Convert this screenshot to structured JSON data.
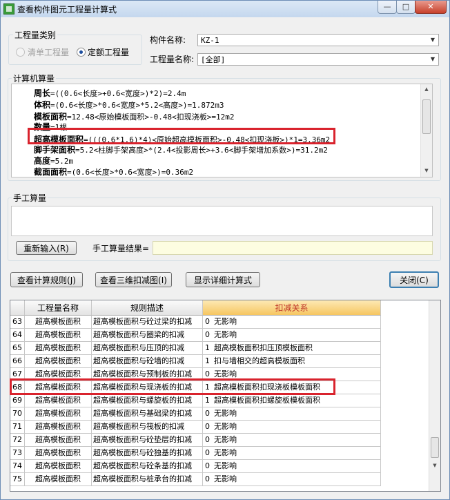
{
  "window": {
    "title": "查看构件图元工程量计算式",
    "controls": {
      "minimize": "—",
      "maximize": "□",
      "close": "✕"
    }
  },
  "quantity_type": {
    "group_label": "工程量类别",
    "options": [
      {
        "label": "清单工程量",
        "selected": false,
        "enabled": false
      },
      {
        "label": "定额工程量",
        "selected": true,
        "enabled": true
      }
    ]
  },
  "component": {
    "label": "构件名称:",
    "value": "KZ-1"
  },
  "quantity_name": {
    "label": "工程量名称:",
    "value": "[全部]"
  },
  "computer_calc": {
    "group_label": "计算机算量",
    "lines": [
      {
        "name": "周长",
        "expr": "=((0.6<长度>+0.6<宽度>)*2)=2.4m"
      },
      {
        "name": "体积",
        "expr": "=(0.6<长度>*0.6<宽度>*5.2<高度>)=1.872m3"
      },
      {
        "name": "模板面积",
        "expr": "=12.48<原始模板面积>-0.48<扣现浇板>=12m2"
      },
      {
        "name": "数量",
        "expr": "=1根"
      },
      {
        "name": "超高模板面积",
        "expr": "=(((0.6*1.6)*4)<原始超高模板面积>-0.48<扣现浇板>)*1=3.36m2"
      },
      {
        "name": "脚手架面积",
        "expr": "=5.2<柱脚手架高度>*(2.4<投影周长>+3.6<脚手架增加系数>)=31.2m2"
      },
      {
        "name": "高度",
        "expr": "=5.2m"
      },
      {
        "name": "截面面积",
        "expr": "=(0.6<长度>*0.6<宽度>)=0.36m2"
      }
    ]
  },
  "manual_calc": {
    "group_label": "手工算量",
    "reenter_button": "重新输入(R)",
    "result_label": "手工算量结果=",
    "result_value": ""
  },
  "buttons": {
    "view_rules": "查看计算规则(J)",
    "view_3d": "查看三维扣减图(I)",
    "show_detail": "显示详细计算式",
    "close": "关闭(C)"
  },
  "table": {
    "columns": [
      "",
      "工程量名称",
      "规则描述",
      "扣减关系"
    ],
    "rows": [
      {
        "num": "63",
        "name": "超高模板面积",
        "rule": "超高模板面积与砼过梁的扣减",
        "code": "0",
        "relation": "无影响"
      },
      {
        "num": "64",
        "name": "超高模板面积",
        "rule": "超高模板面积与圈梁的扣减",
        "code": "0",
        "relation": "无影响"
      },
      {
        "num": "65",
        "name": "超高模板面积",
        "rule": "超高模板面积与压顶的扣减",
        "code": "1",
        "relation": "超高模板面积扣压顶模板面积"
      },
      {
        "num": "66",
        "name": "超高模板面积",
        "rule": "超高模板面积与砼墙的扣减",
        "code": "1",
        "relation": "扣与墙相交的超高模板面积"
      },
      {
        "num": "67",
        "name": "超高模板面积",
        "rule": "超高模板面积与预制板的扣减",
        "code": "0",
        "relation": "无影响"
      },
      {
        "num": "68",
        "name": "超高模板面积",
        "rule": "超高模板面积与现浇板的扣减",
        "code": "1",
        "relation": "超高模板面积扣现浇板模板面积"
      },
      {
        "num": "69",
        "name": "超高模板面积",
        "rule": "超高模板面积与螺旋板的扣减",
        "code": "1",
        "relation": "超高模板面积扣螺旋板模板面积"
      },
      {
        "num": "70",
        "name": "超高模板面积",
        "rule": "超高模板面积与基础梁的扣减",
        "code": "0",
        "relation": "无影响"
      },
      {
        "num": "71",
        "name": "超高模板面积",
        "rule": "超高模板面积与筏板的扣减",
        "code": "0",
        "relation": "无影响"
      },
      {
        "num": "72",
        "name": "超高模板面积",
        "rule": "超高模板面积与砼垫层的扣减",
        "code": "0",
        "relation": "无影响"
      },
      {
        "num": "73",
        "name": "超高模板面积",
        "rule": "超高模板面积与砼独基的扣减",
        "code": "0",
        "relation": "无影响"
      },
      {
        "num": "74",
        "name": "超高模板面积",
        "rule": "超高模板面积与砼条基的扣减",
        "code": "0",
        "relation": "无影响"
      },
      {
        "num": "75",
        "name": "超高模板面积",
        "rule": "超高模板面积与桩承台的扣减",
        "code": "0",
        "relation": "无影响"
      }
    ]
  },
  "colors": {
    "highlight_border": "#d9232d",
    "active_header": "#f6c661"
  }
}
